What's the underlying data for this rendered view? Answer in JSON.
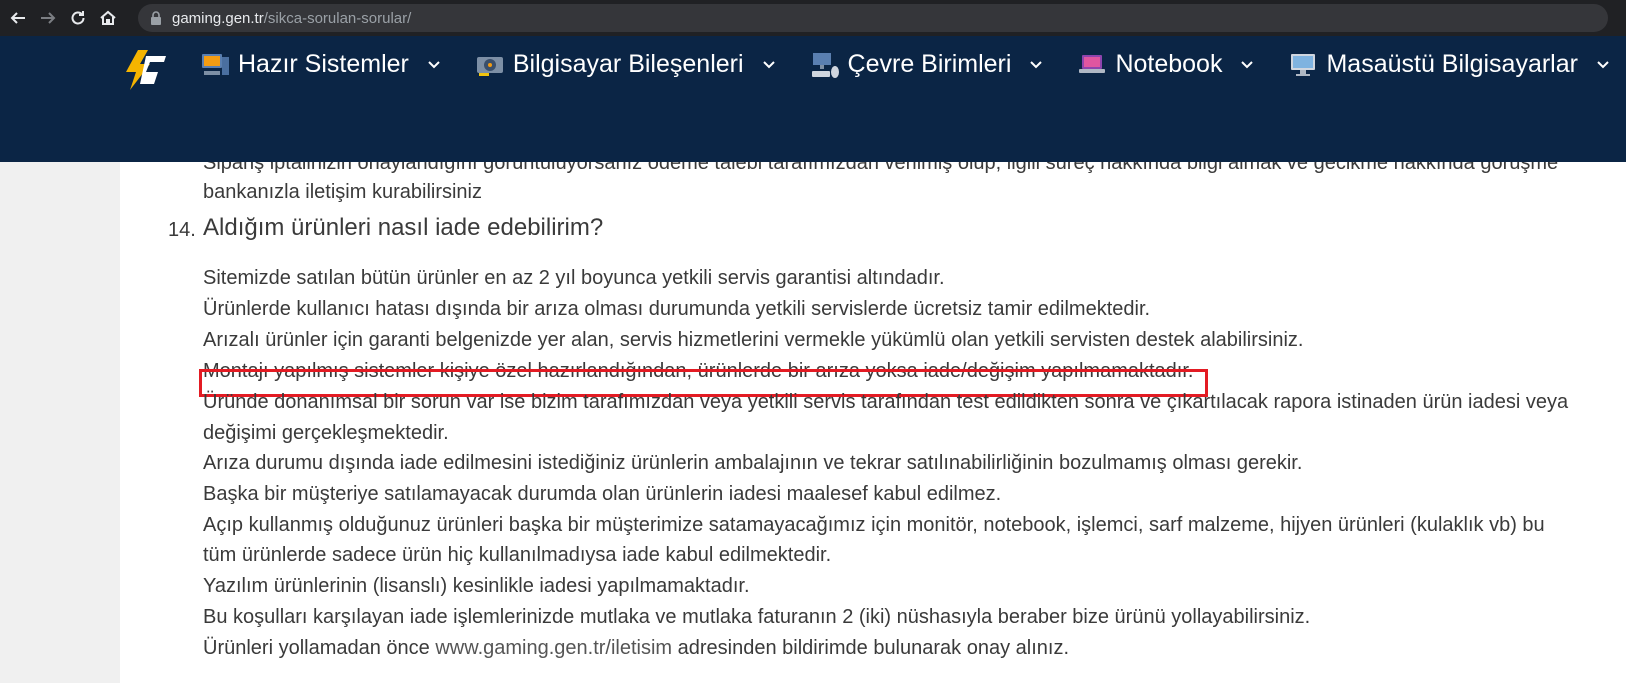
{
  "browser": {
    "url_host": "gaming.gen.tr",
    "url_path": "/sikca-sorulan-sorular/"
  },
  "nav": {
    "items": [
      {
        "label": "Hazır Sistemler",
        "icon": "gaming-pc-icon"
      },
      {
        "label": "Bilgisayar Bileşenleri",
        "icon": "graphics-card-icon"
      },
      {
        "label": "Çevre Birimleri",
        "icon": "peripherals-icon"
      },
      {
        "label": "Notebook",
        "icon": "laptop-icon"
      },
      {
        "label": "Masaüstü Bilgisayarlar",
        "icon": "desktop-icon"
      }
    ]
  },
  "content": {
    "prev_line1": "Sipariş iptalinizin onaylandığını görüntülüyorsanız ödeme talebi tarafımızdan verilmiş olup, ilgili süreç hakkında bilgi almak ve gecikme hakkında görüşme",
    "prev_line2": "bankanızla iletişim kurabilirsiniz",
    "question_number": "14.",
    "question_title": "Aldığım ürünleri nasıl iade edebilirim?",
    "lines": [
      "Sitemizde satılan bütün ürünler en az 2 yıl boyunca yetkili servis garantisi altındadır.",
      "Ürünlerde kullanıcı hatası dışında bir arıza olması durumunda yetkili servislerde ücretsiz tamir edilmektedir.",
      "Arızalı ürünler için garanti belgenizde yer alan, servis hizmetlerini vermekle yükümlü olan yetkili servisten destek alabilirsiniz.",
      "Montajı yapılmış sistemler kişiye özel hazırlandığından, ürünlerde bir arıza yoksa iade/değişim yapılmamaktadır.",
      "Üründe donanımsal bir sorun var ise bizim tarafımızdan veya yetkili servis tarafından test edildikten sonra ve çıkartılacak rapora istinaden ürün iadesi veya",
      "değişimi gerçekleşmektedir.",
      "Arıza durumu dışında iade edilmesini istediğiniz ürünlerin ambalajının ve tekrar satılınabilirliğinin bozulmamış olması gerekir.",
      "Başka bir müşteriye satılamayacak durumda olan ürünlerin iadesi maalesef kabul edilmez.",
      "Açıp kullanmış olduğunuz ürünleri başka bir müşterimize satamayacağımız için monitör, notebook, işlemci, sarf malzeme, hijyen ürünleri (kulaklık vb)  bu",
      "tüm ürünlerde sadece ürün hiç kullanılmadıysa iade kabul edilmektedir.",
      "Yazılım ürünlerinin (lisanslı) kesinlikle iadesi yapılmamaktadır.",
      "Bu koşulları karşılayan iade işlemlerinizde mutlaka ve mutlaka faturanın 2 (iki) nüshasıyla beraber bize ürünü yollayabilirsiniz."
    ],
    "last_line_before": "Ürünleri yollamadan önce ",
    "last_line_link": "www.gaming.gen.tr/iletisim",
    "last_line_after": " adresinden bildirimde bulunarak onay alınız."
  },
  "colors": {
    "header_bg": "#0b2545",
    "highlight": "#e31b23",
    "logo_accent": "#f5b400"
  }
}
